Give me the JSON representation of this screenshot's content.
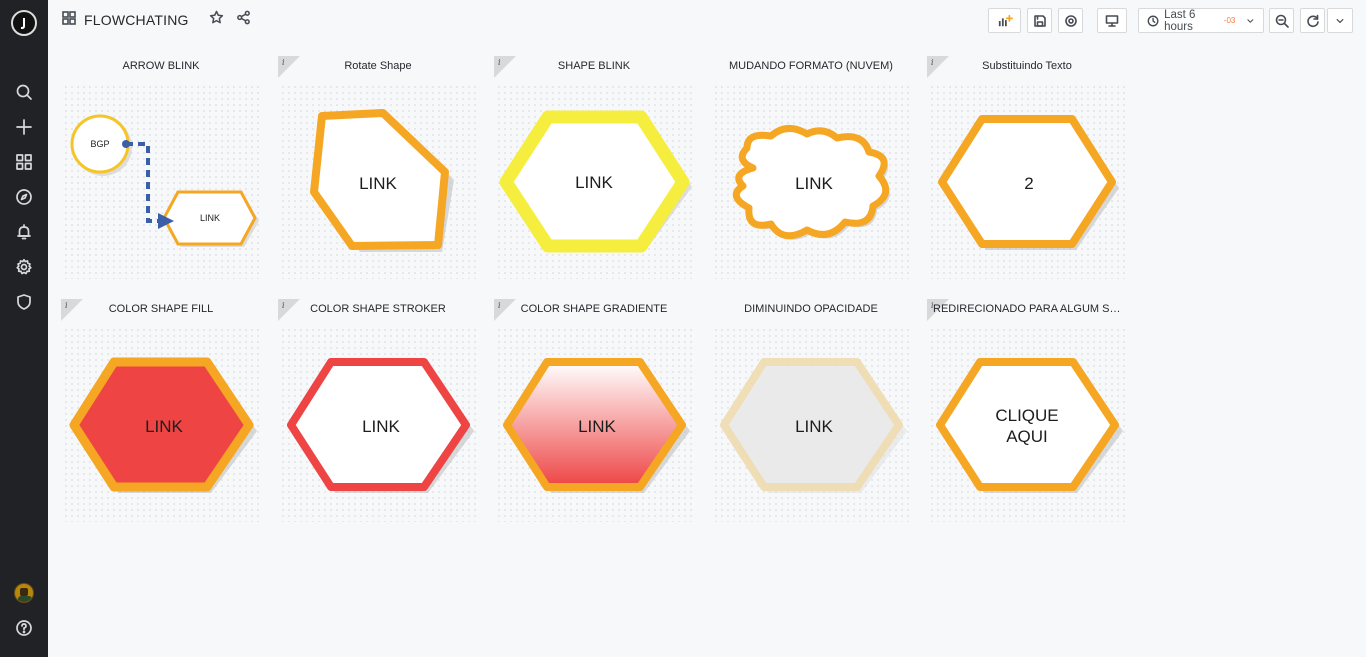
{
  "sidebar": {
    "items": [
      {
        "icon": "search-icon"
      },
      {
        "icon": "plus-icon"
      },
      {
        "icon": "dashboards-icon"
      },
      {
        "icon": "compass-icon"
      },
      {
        "icon": "bell-icon"
      },
      {
        "icon": "gear-icon"
      },
      {
        "icon": "shield-icon"
      }
    ],
    "help_icon": "help-icon"
  },
  "header": {
    "title": "FLOWCHATING",
    "time_range": "Last 6 hours",
    "timezone": "-03"
  },
  "panels": [
    {
      "title": "ARROW BLINK",
      "info": false,
      "node1": "BGP",
      "node2": "LINK"
    },
    {
      "title": "Rotate Shape",
      "info": true,
      "label": "LINK"
    },
    {
      "title": "SHAPE BLINK",
      "info": true,
      "label": "LINK"
    },
    {
      "title": "MUDANDO FORMATO (NUVEM)",
      "info": false,
      "label": "LINK"
    },
    {
      "title": "Substituindo Texto",
      "info": true,
      "label": "2"
    },
    {
      "title": "COLOR SHAPE FILL",
      "info": true,
      "label": "LINK"
    },
    {
      "title": "COLOR SHAPE STROKER",
      "info": true,
      "label": "LINK"
    },
    {
      "title": "COLOR SHAPE GRADIENTE",
      "info": true,
      "label": "LINK"
    },
    {
      "title": "DIMINUINDO OPACIDADE",
      "info": false,
      "label": "LINK"
    },
    {
      "title": "REDIRECIONADO PARA ALGUM SI...",
      "info": true,
      "label_line1": "CLIQUE",
      "label_line2": "AQUI"
    }
  ],
  "colors": {
    "orange": "#f5a623",
    "yellow": "#f5ee3f",
    "red": "#ee4444",
    "arrow": "#3a5fa8"
  }
}
